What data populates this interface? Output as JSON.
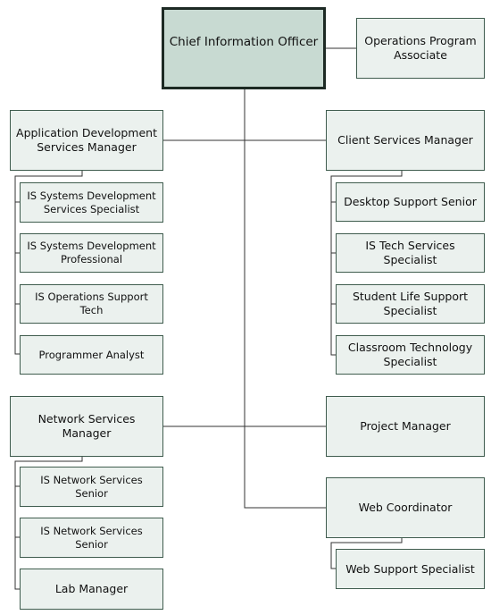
{
  "colors": {
    "root_fill": "#c8dad2",
    "box_fill": "#ebf1ee",
    "border": "#3f5c4e",
    "line": "#333333"
  },
  "root": {
    "title": "Chief Information Officer"
  },
  "assistant": {
    "title": "Operations Program Associate"
  },
  "managers": [
    {
      "title": "Application Development Services Manager",
      "reports": [
        "IS Systems Development Services Specialist",
        "IS Systems Development Professional",
        "IS Operations Support Tech",
        "Programmer Analyst"
      ]
    },
    {
      "title": "Client Services Manager",
      "reports": [
        "Desktop Support Senior",
        "IS Tech Services Specialist",
        "Student Life Support Specialist",
        "Classroom Technology Specialist"
      ]
    },
    {
      "title": "Network Services Manager",
      "reports": [
        "IS Network Services Senior",
        "IS Network Services Senior",
        "Lab Manager"
      ]
    },
    {
      "title": "Project Manager",
      "reports": []
    },
    {
      "title": "Web Coordinator",
      "reports": [
        "Web Support Specialist"
      ]
    }
  ]
}
